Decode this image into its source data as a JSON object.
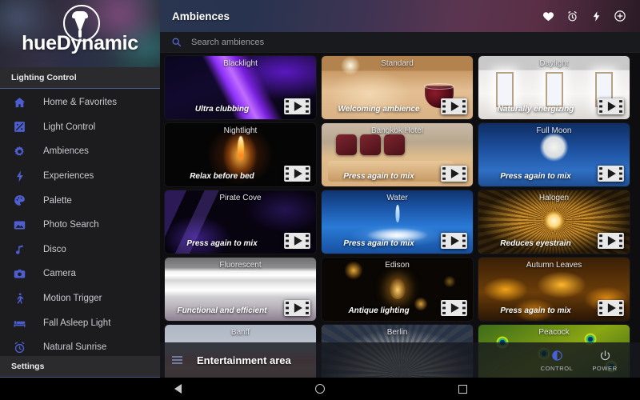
{
  "brand": {
    "name": "hueDynamic",
    "logo_icon": "bulb-icon"
  },
  "sidebar": {
    "section_label": "Lighting Control",
    "footer_label": "Settings",
    "items": [
      {
        "label": "Home & Favorites",
        "icon": "home-icon"
      },
      {
        "label": "Light Control",
        "icon": "slider-icon"
      },
      {
        "label": "Ambiences",
        "icon": "gear-icon"
      },
      {
        "label": "Experiences",
        "icon": "bolt-icon"
      },
      {
        "label": "Palette",
        "icon": "palette-icon"
      },
      {
        "label": "Photo Search",
        "icon": "photo-icon"
      },
      {
        "label": "Disco",
        "icon": "music-note-icon"
      },
      {
        "label": "Camera",
        "icon": "camera-icon"
      },
      {
        "label": "Motion Trigger",
        "icon": "walking-person-icon"
      },
      {
        "label": "Fall Asleep Light",
        "icon": "bed-icon"
      },
      {
        "label": "Natural Sunrise",
        "icon": "alarm-clock-icon"
      }
    ]
  },
  "topbar": {
    "title": "Ambiences",
    "actions": [
      {
        "name": "favorites-button",
        "icon": "heart-icon"
      },
      {
        "name": "timer-button",
        "icon": "alarm-clock-icon"
      },
      {
        "name": "flash-button",
        "icon": "bolt-icon"
      },
      {
        "name": "add-button",
        "icon": "plus-circle-icon"
      }
    ]
  },
  "search": {
    "placeholder": "Search ambiences",
    "value": "",
    "icon": "search-icon"
  },
  "grid": {
    "play_icon": "film-play-icon",
    "cards": [
      {
        "title": "Blacklight",
        "subtitle": "Ultra clubbing",
        "art": "art-blacklight"
      },
      {
        "title": "Standard",
        "subtitle": "Welcoming ambience",
        "art": "art-standard"
      },
      {
        "title": "Daylight",
        "subtitle": "Naturally energizing",
        "art": "art-daylight"
      },
      {
        "title": "Nightlight",
        "subtitle": "Relax before bed",
        "art": "art-nightlight"
      },
      {
        "title": "Bangkok Hotel",
        "subtitle": "Press again to mix",
        "art": "art-bangkok"
      },
      {
        "title": "Full Moon",
        "subtitle": "Press again to mix",
        "art": "art-fullmoon"
      },
      {
        "title": "Pirate Cove",
        "subtitle": "Press again to mix",
        "art": "art-pirate"
      },
      {
        "title": "Water",
        "subtitle": "Press again to mix",
        "art": "art-water"
      },
      {
        "title": "Halogen",
        "subtitle": "Reduces eyestrain",
        "art": "art-halogen"
      },
      {
        "title": "Fluorescent",
        "subtitle": "Functional and efficient",
        "art": "art-fluorescent"
      },
      {
        "title": "Edison",
        "subtitle": "Antique lighting",
        "art": "art-edison"
      },
      {
        "title": "Autumn Leaves",
        "subtitle": "Press again to mix",
        "art": "art-autumn"
      },
      {
        "title": "Banff",
        "subtitle": "",
        "art": "art-banff"
      },
      {
        "title": "Berlin",
        "subtitle": "",
        "art": "art-berlin"
      },
      {
        "title": "Peacock",
        "subtitle": "",
        "art": "art-peacock"
      }
    ]
  },
  "entertainment_bar": {
    "title": "Entertainment area",
    "drag_handle_icon": "drag-handle-icon",
    "actions": [
      {
        "label": "CONTROL",
        "icon": "brightness-icon"
      },
      {
        "label": "POWER",
        "icon": "power-icon"
      }
    ]
  },
  "navbar": {
    "buttons": [
      {
        "name": "back-button",
        "icon": "triangle-back-icon"
      },
      {
        "name": "home-button",
        "icon": "circle-home-icon"
      },
      {
        "name": "recents-button",
        "icon": "square-recents-icon"
      }
    ]
  },
  "colors": {
    "accent": "#4d5fd0",
    "panel": "#1c1c1e",
    "background": "#0e0e10",
    "text": "#c9cace"
  }
}
